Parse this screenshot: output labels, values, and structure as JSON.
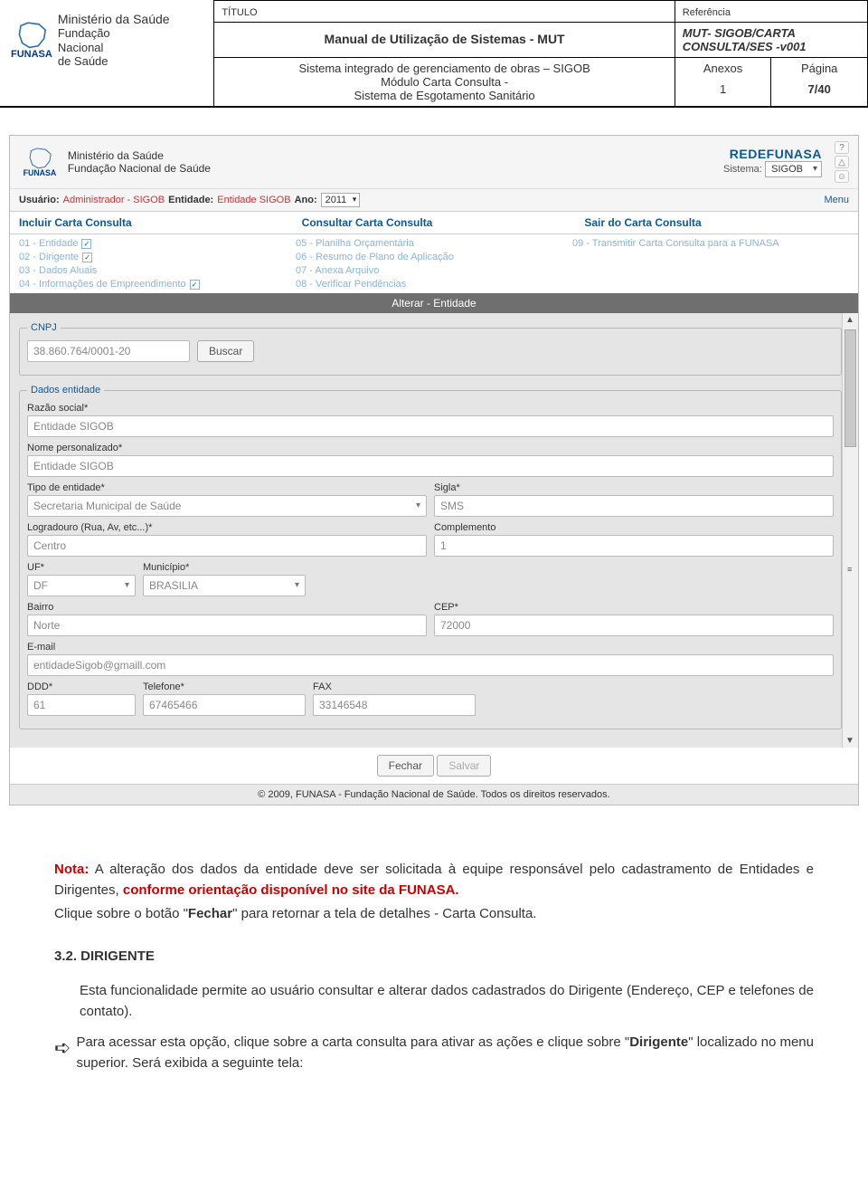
{
  "header": {
    "titulo_label": "TÍTULO",
    "referencia_label": "Referência",
    "manual_title": "Manual de Utilização de Sistemas - MUT",
    "ref_line1": "MUT- SIGOB/CARTA",
    "ref_line2": "CONSULTA/SES -v001",
    "subtitle_line1": "Sistema integrado de gerenciamento de obras – SIGOB",
    "subtitle_line2": "Módulo Carta Consulta -",
    "subtitle_line3": "Sistema de Esgotamento Sanitário",
    "anexos_label": "Anexos",
    "anexos_value": "1",
    "pagina_label": "Página",
    "pagina_value": "7/40",
    "logo_ministerio": "Ministério da Saúde",
    "logo_fundacao1": "Fundação",
    "logo_fundacao2": "Nacional",
    "logo_fundacao3": "de Saúde",
    "funasa_label": "FUNASA"
  },
  "app": {
    "brand_min": "Ministério da Saúde",
    "brand_fund": "Fundação Nacional de Saúde",
    "redefunasa": "REDEFUNASA",
    "sistema_label": "Sistema:",
    "sistema_value": "SIGOB",
    "userbar": {
      "usuario_label": "Usuário:",
      "usuario_value": "Administrador - SIGOB",
      "entidade_label": "Entidade:",
      "entidade_value": "Entidade SIGOB",
      "ano_label": "Ano:",
      "ano_value": "2011",
      "menu": "Menu"
    },
    "nav": {
      "incluir": "Incluir Carta Consulta",
      "consultar": "Consultar Carta Consulta",
      "sair": "Sair do Carta Consulta"
    },
    "steps": {
      "s01": "01 - Entidade",
      "s05": "05 - Planilha Orçamentária",
      "s09": "09 - Transmitir Carta Consulta para a FUNASA",
      "s02": "02 - Dirigente",
      "s06": "06 - Resumo de Plano de Aplicação",
      "s03": "03 - Dados Aluais",
      "s07": "07 - Anexa Arquivo",
      "s04": "04 - Informações de Empreendimento",
      "s08": "08 - Verificar Pendências"
    },
    "section_title": "Alterar - Entidade",
    "cnpj": {
      "legend": "CNPJ",
      "value": "38.860.764/0001-20",
      "buscar": "Buscar"
    },
    "dados": {
      "legend": "Dados entidade",
      "razao_label": "Razão social*",
      "razao_value": "Entidade SIGOB",
      "nome_label": "Nome personalizado*",
      "nome_value": "Entidade SIGOB",
      "tipo_label": "Tipo de entidade*",
      "tipo_value": "Secretaria Municipal de Saúde",
      "sigla_label": "Sigla*",
      "sigla_value": "SMS",
      "logradouro_label": "Logradouro (Rua, Av, etc...)*",
      "logradouro_value": "Centro",
      "complemento_label": "Complemento",
      "complemento_value": "1",
      "uf_label": "UF*",
      "uf_value": "DF",
      "municipio_label": "Município*",
      "municipio_value": "BRASILIA",
      "bairro_label": "Bairro",
      "bairro_value": "Norte",
      "cep_label": "CEP*",
      "cep_value": "72000",
      "email_label": "E-mail",
      "email_value": "entidadeSigob@gmaill.com",
      "ddd_label": "DDD*",
      "ddd_value": "61",
      "telefone_label": "Telefone*",
      "telefone_value": "67465466",
      "fax_label": "FAX",
      "fax_value": "33146548"
    },
    "buttons": {
      "fechar": "Fechar",
      "salvar": "Salvar"
    },
    "copyright": "© 2009, FUNASA - Fundação Nacional de Saúde. Todos os direitos reservados."
  },
  "body": {
    "nota_label": "Nota:",
    "nota_text_1": " A alteração dos dados da entidade deve ser solicitada à equipe responsável pelo cadastramento de Entidades e Dirigentes, ",
    "nota_red": "conforme orientação disponível no site da FUNASA.",
    "nota_text_2": "Clique sobre o botão \"",
    "nota_bold_fechar": "Fechar",
    "nota_text_3": "\" para retornar a tela de detalhes - Carta Consulta.",
    "section_number": "3.2. DIRIGENTE",
    "p1": "Esta funcionalidade permite ao usuário consultar e alterar dados cadastrados do Dirigente (Endereço, CEP e telefones de contato).",
    "p2_a": "Para acessar esta opção, clique sobre a carta consulta para ativar as ações e clique sobre \"",
    "p2_bold": "Dirigente",
    "p2_b": "\" localizado no menu superior. Será exibida a seguinte tela:"
  }
}
